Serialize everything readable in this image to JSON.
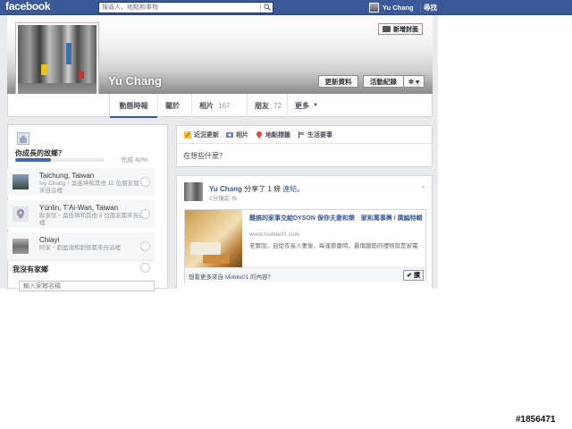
{
  "topbar": {
    "logo": "facebook",
    "search_placeholder": "搜尋人、地點和事物",
    "user_name": "Yu Chang",
    "find_friends": "尋找"
  },
  "cover": {
    "add_cover_label": "新增封面",
    "profile_name": "Yu Chang",
    "update_info_label": "更新資料",
    "activity_log_label": "活動紀錄",
    "gear_label": "✲ ▾"
  },
  "tabs": [
    {
      "label": "動態時報"
    },
    {
      "label": "關於"
    },
    {
      "label": "相片",
      "count": "167"
    },
    {
      "label": "朋友",
      "count": "72"
    },
    {
      "label": "更多"
    }
  ],
  "hometown": {
    "question": "你成長的故鄉？",
    "progress_fraction": 0.4,
    "progress_text": "完成 40%",
    "suggestions": [
      {
        "title": "Taichung, Taiwan",
        "desc": "Ivy Chang・吳進坤和其他 12 位朋友都來自這裡"
      },
      {
        "title": "Yünlin, T'Ai-Wan, Taiwan",
        "desc": "歐家欣・吳佳璘和其他 3 位朋友都來自這裡"
      },
      {
        "title": "Chiayi",
        "desc": "阿家・劉盈達和劉德都來自這裡"
      }
    ],
    "no_home_label": "我沒有家鄉",
    "input_placeholder": "輸入家鄉名稱"
  },
  "composer": {
    "tabs": [
      "近況更新",
      "相片",
      "地點標籤",
      "生活要事"
    ],
    "prompt": "在想些什麼？"
  },
  "post": {
    "author": "Yu Chang",
    "action": "分享了 1 條",
    "link_word": "連結",
    "punct": "。",
    "time": "2分鐘前",
    "privacy_icon": "⊕",
    "share_title": "難搞的家事交給DYSON 保你夫妻和樂　家和萬事興 / 廣編特輯",
    "share_url": "www.mobile01.com",
    "share_desc": "老實說，自從衣長人妻後，每逢節慶時，最傷腦筋的禮物就是家電",
    "foot_prefix": "想看更多來自 ",
    "foot_link": "Mobile01",
    "foot_suffix": " 的內容？",
    "like_label": "讚"
  },
  "watermark": "#1856471",
  "colors": {
    "brand": "#3b5998",
    "page_bg": "#e9eaed",
    "progress": "#4267b2"
  }
}
